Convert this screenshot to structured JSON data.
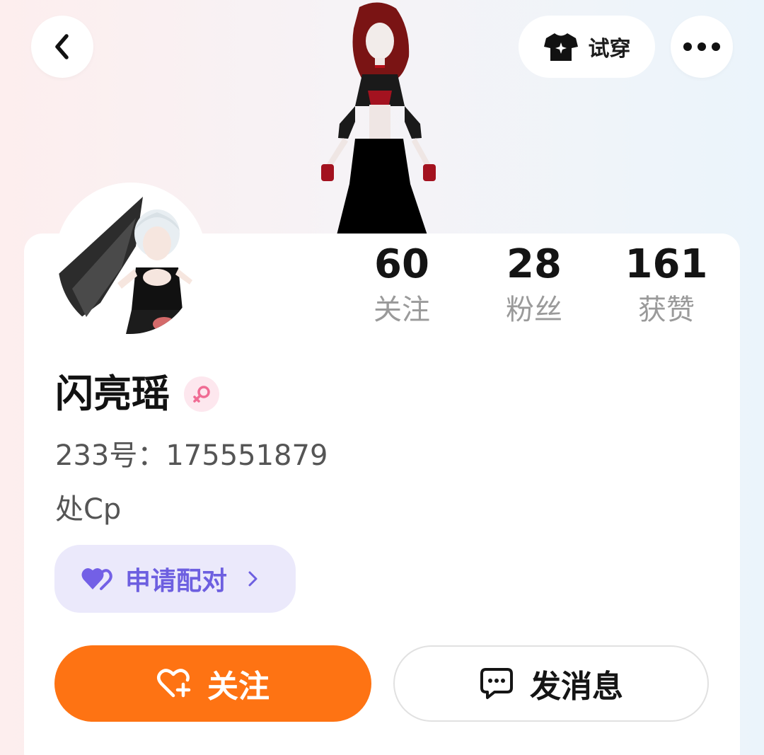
{
  "header": {
    "back_icon": "chevron-left-icon",
    "try_on": {
      "icon": "tshirt-sparkle-icon",
      "label": "试穿"
    },
    "more_icon": "more-dots-icon"
  },
  "profile": {
    "name": "闪亮瑶",
    "gender_icon": "female-icon",
    "user_id": "233号：175551879",
    "bio": "处Cp"
  },
  "stats": [
    {
      "value": "60",
      "label": "关注"
    },
    {
      "value": "28",
      "label": "粉丝"
    },
    {
      "value": "161",
      "label": "获赞"
    }
  ],
  "pair_button": {
    "icon": "heart-pair-icon",
    "label": "申请配对"
  },
  "actions": {
    "follow": {
      "icon": "heart-plus-icon",
      "label": "关注"
    },
    "message": {
      "icon": "chat-bubble-icon",
      "label": "发消息"
    }
  },
  "colors": {
    "follow": "#fe7313",
    "pair_bg": "#ebe9fb",
    "pair_text": "#6d5fe0",
    "gender_bg": "#fde7ee",
    "gender_icon": "#f06c94"
  }
}
